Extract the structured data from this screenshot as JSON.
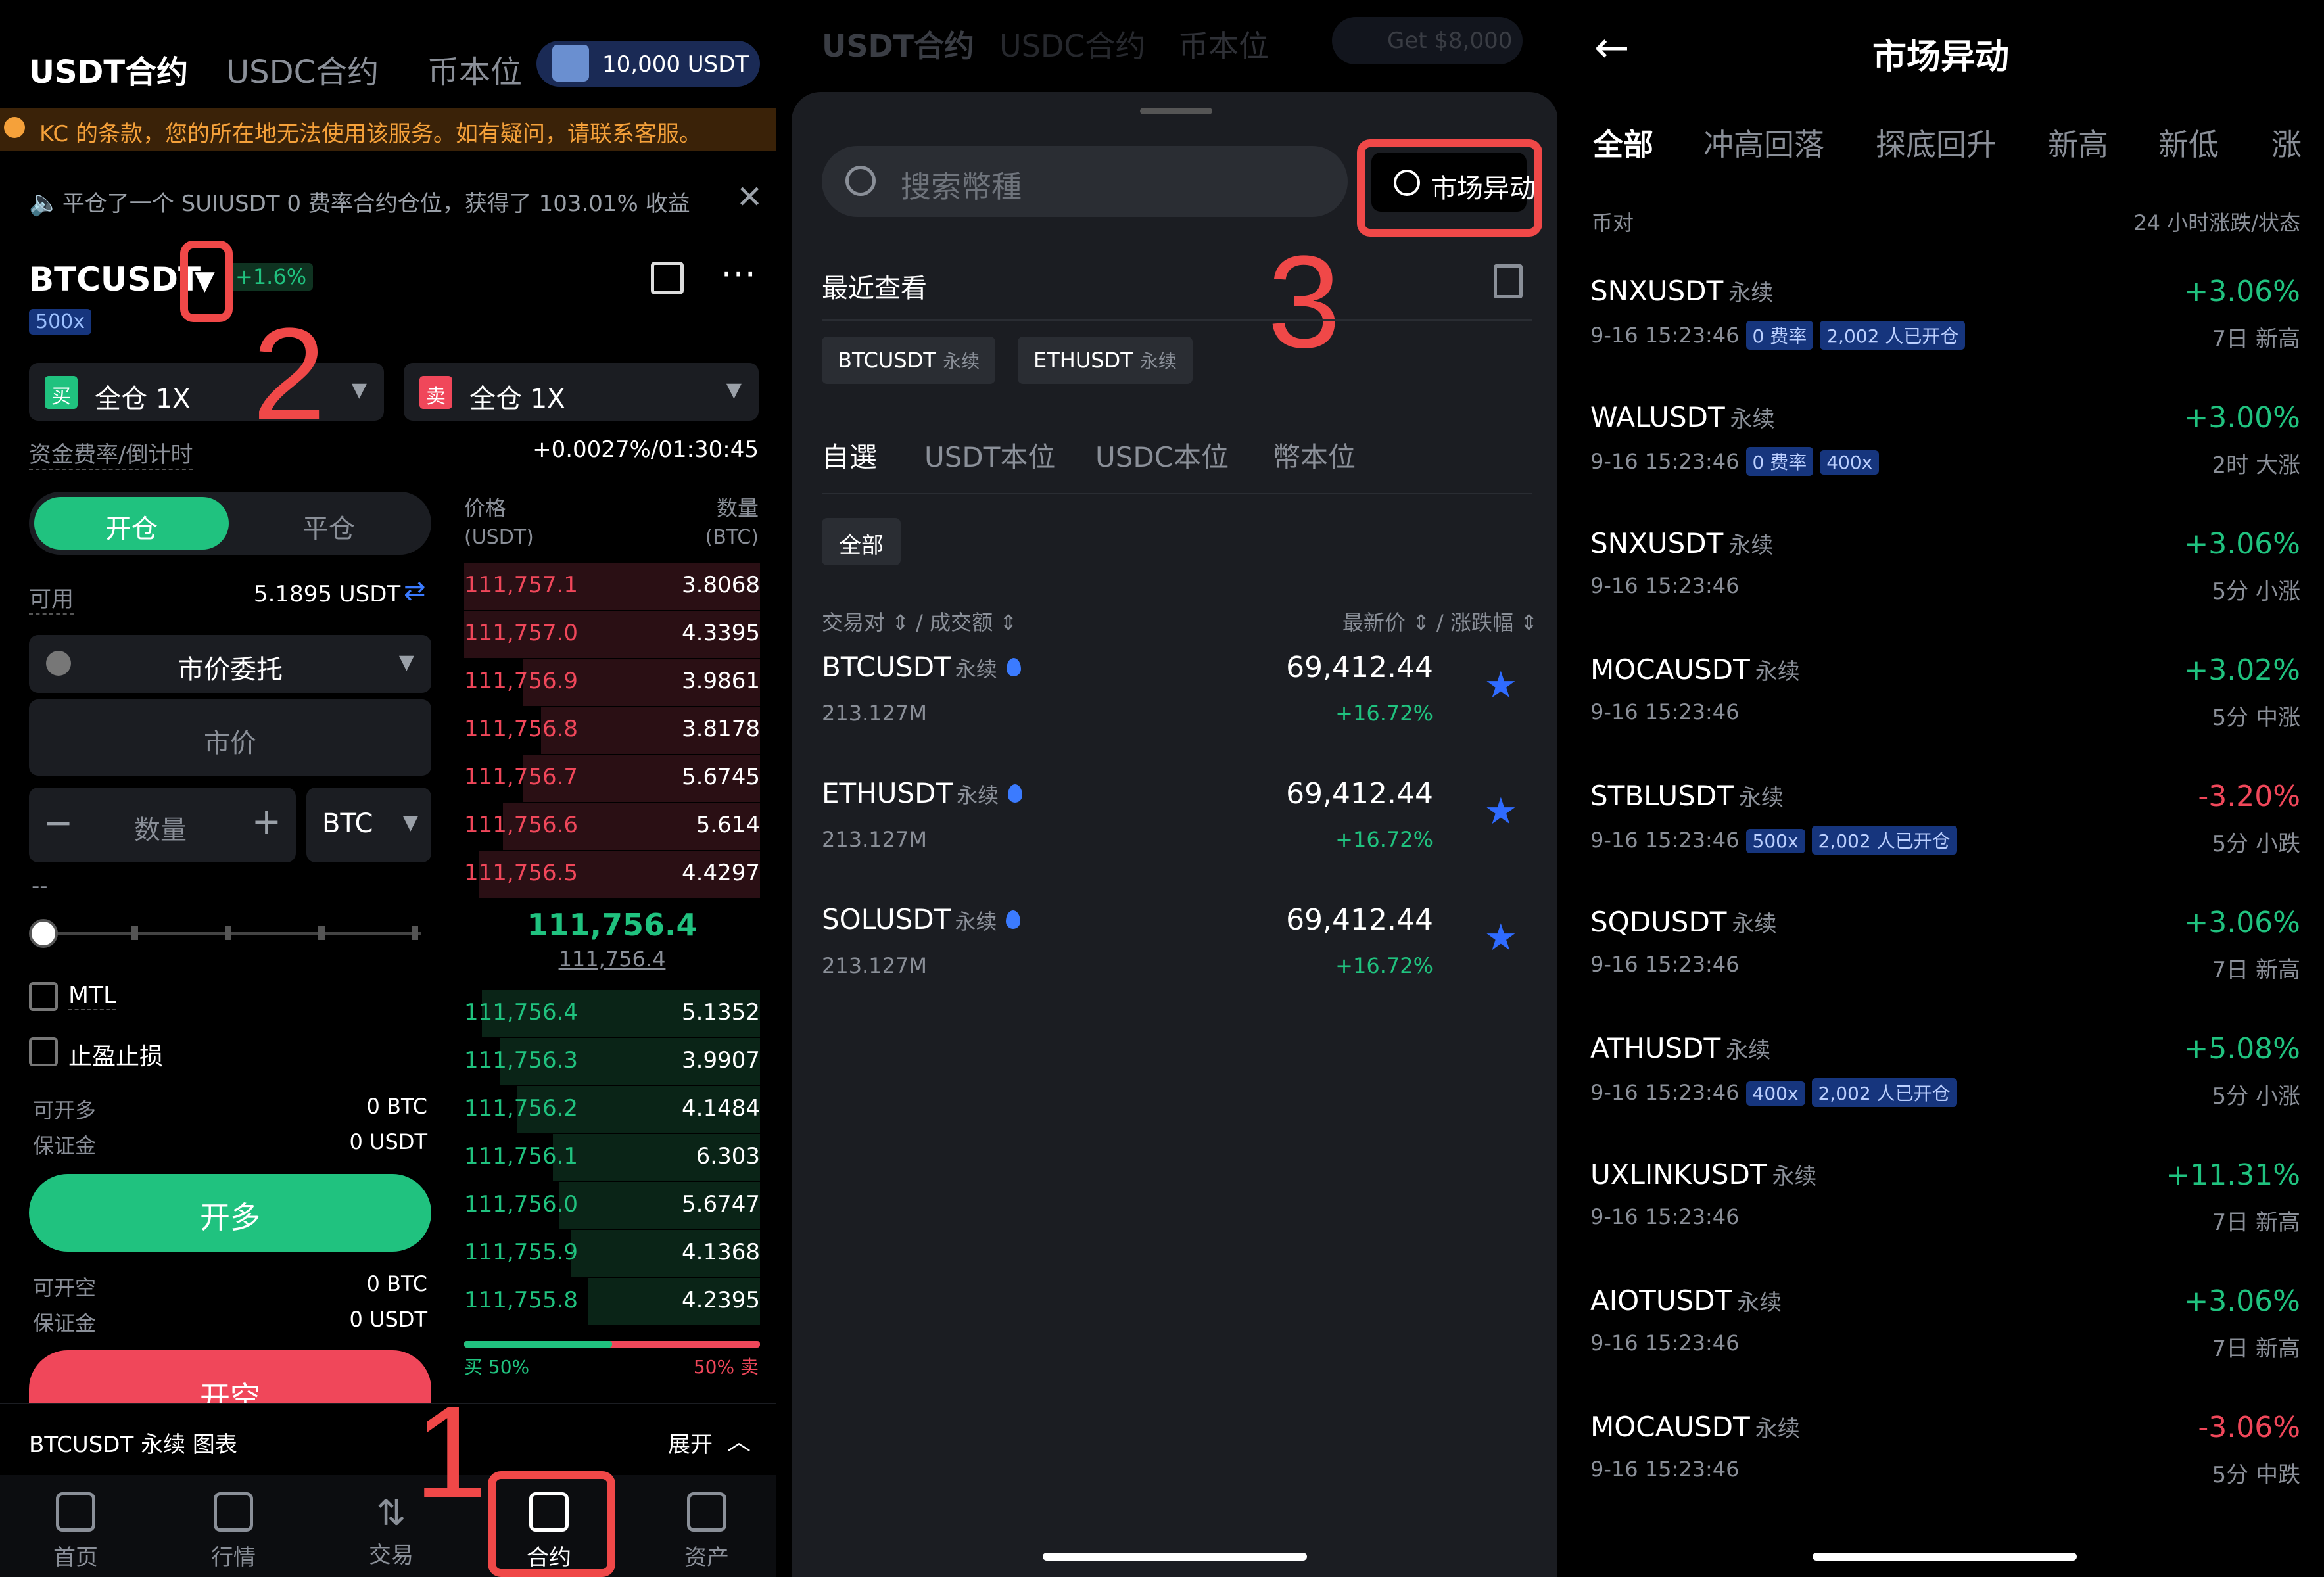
{
  "p1": {
    "tabs": [
      "USDT合约",
      "USDC合约",
      "币本位"
    ],
    "promo": "10,000 USDT",
    "warning": "KC 的条款，您的所在地无法使用该服务。如有疑问，请联系客服。",
    "ticker": "平仓了一个 SUIUSDT 0 费率合约仓位，获得了 103.01% 收益",
    "symbol": "BTCUSDT",
    "change": "+1.6%",
    "leverage": "500x",
    "buy_label": "买",
    "sell_label": "卖",
    "buy_mode": "全仓 1X",
    "sell_mode": "全仓 1X",
    "funding_label": "资金费率/倒计时",
    "funding_value": "+0.0027%/01:30:45",
    "open_tab": "开仓",
    "close_tab": "平仓",
    "available_label": "可用",
    "available_value": "5.1895 USDT",
    "order_type": "市价委托",
    "market_price": "市价",
    "qty_placeholder": "数量",
    "qty_unit": "BTC",
    "dash": "--",
    "mtl": "MTL",
    "tpsl": "止盈止损",
    "can_long_label": "可开多",
    "can_long_value": "0 BTC",
    "margin_label": "保证金",
    "margin_value": "0 USDT",
    "long_btn": "开多",
    "can_short_label": "可开空",
    "can_short_value": "0 BTC",
    "margin2_label": "保证金",
    "margin2_value": "0 USDT",
    "short_btn": "开空",
    "ob_price_h": "价格",
    "ob_price_unit": "(USDT)",
    "ob_qty_h": "数量",
    "ob_qty_unit": "(BTC)",
    "asks": [
      {
        "p": "111,757.1",
        "q": "3.8068",
        "depth": 0.0
      },
      {
        "p": "111,757.0",
        "q": "4.3395",
        "depth": 0.0
      },
      {
        "p": "111,756.9",
        "q": "3.9861",
        "depth": 0.2
      },
      {
        "p": "111,756.8",
        "q": "3.8178",
        "depth": 0.26
      },
      {
        "p": "111,756.7",
        "q": "5.6745",
        "depth": 0.2
      },
      {
        "p": "111,756.6",
        "q": "5.614",
        "depth": 0.13
      },
      {
        "p": "111,756.5",
        "q": "4.4297",
        "depth": 0.05
      }
    ],
    "mid_price": "111,756.4",
    "mark_price": "111,756.4",
    "bids": [
      {
        "p": "111,756.4",
        "q": "5.1352",
        "depth": 0.06
      },
      {
        "p": "111,756.3",
        "q": "3.9907",
        "depth": 0.12
      },
      {
        "p": "111,756.2",
        "q": "4.1484",
        "depth": 0.18
      },
      {
        "p": "111,756.1",
        "q": "6.303",
        "depth": 0.3
      },
      {
        "p": "111,756.0",
        "q": "5.6747",
        "depth": 0.32
      },
      {
        "p": "111,755.9",
        "q": "4.1368",
        "depth": 0.36
      },
      {
        "p": "111,755.8",
        "q": "4.2395",
        "depth": 0.42
      }
    ],
    "buy_ratio_label": "买 50%",
    "sell_ratio_label": "50% 卖",
    "buy_ratio": 0.5,
    "chart_bar": "BTCUSDT 永续 图表",
    "expand": "展开",
    "nav": [
      "首页",
      "行情",
      "交易",
      "合约",
      "资产"
    ],
    "ann1": "1",
    "ann2": "2"
  },
  "p2": {
    "tabs": [
      "USDT合约",
      "USDC合约",
      "币本位"
    ],
    "promo": "Get $8,000",
    "search_placeholder": "搜索幣種",
    "market_btn": "市场异动",
    "recent": "最近查看",
    "recent_chips": [
      {
        "sym": "BTCUSDT",
        "tag": "永续"
      },
      {
        "sym": "ETHUSDT",
        "tag": "永续"
      }
    ],
    "cat_tabs": [
      "自選",
      "USDT本位",
      "USDC本位",
      "幣本位"
    ],
    "filter": "全部",
    "col_left": "交易对 ⇕ / 成交额 ⇕",
    "col_right": "最新价 ⇕ / 涨跌幅 ⇕",
    "rows": [
      {
        "sym": "BTCUSDT",
        "tag": "永续",
        "vol": "213.127M",
        "price": "69,412.44",
        "chg": "+16.72%"
      },
      {
        "sym": "ETHUSDT",
        "tag": "永续",
        "vol": "213.127M",
        "price": "69,412.44",
        "chg": "+16.72%"
      },
      {
        "sym": "SOLUSDT",
        "tag": "永续",
        "vol": "213.127M",
        "price": "69,412.44",
        "chg": "+16.72%"
      }
    ],
    "ann3": "3"
  },
  "p3": {
    "title": "市场异动",
    "tabs": [
      "全部",
      "冲高回落",
      "探底回升",
      "新高",
      "新低",
      "涨"
    ],
    "col_left": "币对",
    "col_right": "24 小时涨跌/状态",
    "rows": [
      {
        "sym": "SNXUSDT",
        "tag": "永续",
        "time": "9-16 15:23:46",
        "badges": [
          "0 费率",
          "2,002 人已开仓"
        ],
        "chg": "+3.06%",
        "state": "7日 新高",
        "up": true
      },
      {
        "sym": "WALUSDT",
        "tag": "永续",
        "time": "9-16 15:23:46",
        "badges": [
          "0 费率",
          "400x"
        ],
        "chg": "+3.00%",
        "state": "2时 大涨",
        "up": true
      },
      {
        "sym": "SNXUSDT",
        "tag": "永续",
        "time": "9-16 15:23:46",
        "badges": [],
        "chg": "+3.06%",
        "state": "5分 小涨",
        "up": true
      },
      {
        "sym": "MOCAUSDT",
        "tag": "永续",
        "time": "9-16 15:23:46",
        "badges": [],
        "chg": "+3.02%",
        "state": "5分 中涨",
        "up": true
      },
      {
        "sym": "STBLUSDT",
        "tag": "永续",
        "time": "9-16 15:23:46",
        "badges": [
          "500x",
          "2,002 人已开仓"
        ],
        "chg": "-3.20%",
        "state": "5分 小跌",
        "up": false
      },
      {
        "sym": "SQDUSDT",
        "tag": "永续",
        "time": "9-16 15:23:46",
        "badges": [],
        "chg": "+3.06%",
        "state": "7日 新高",
        "up": true
      },
      {
        "sym": "ATHUSDT",
        "tag": "永续",
        "time": "9-16 15:23:46",
        "badges": [
          "400x",
          "2,002 人已开仓"
        ],
        "chg": "+5.08%",
        "state": "5分 小涨",
        "up": true
      },
      {
        "sym": "UXLINKUSDT",
        "tag": "永续",
        "time": "9-16 15:23:46",
        "badges": [],
        "chg": "+11.31%",
        "state": "7日 新高",
        "up": true
      },
      {
        "sym": "AIOTUSDT",
        "tag": "永续",
        "time": "9-16 15:23:46",
        "badges": [],
        "chg": "+3.06%",
        "state": "7日 新高",
        "up": true
      },
      {
        "sym": "MOCAUSDT",
        "tag": "永续",
        "time": "9-16 15:23:46",
        "badges": [],
        "chg": "-3.06%",
        "state": "5分 中跌",
        "up": false
      }
    ]
  },
  "colors": {
    "green": "#20c27f",
    "red": "#f0475a",
    "accent": "#f04848",
    "badge": "#16357d"
  }
}
